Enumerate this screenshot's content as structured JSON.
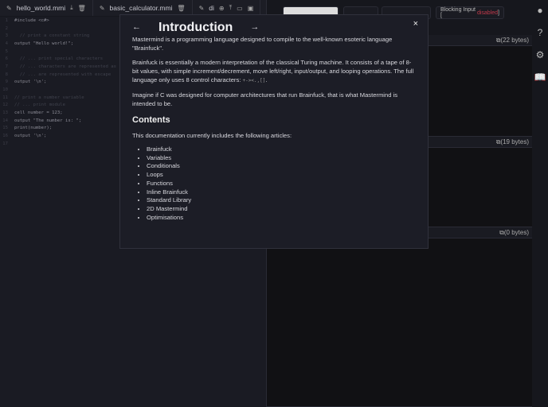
{
  "tabs": [
    {
      "label": "hello_world.mmi"
    },
    {
      "label": "basic_calculator.mmi"
    },
    {
      "label": "di"
    }
  ],
  "code": [
    {
      "n": "1",
      "t": "#include <c#>",
      "c": false
    },
    {
      "n": "2",
      "t": "",
      "c": false
    },
    {
      "n": "3",
      "t": "  // print a constant string",
      "c": true
    },
    {
      "n": "4",
      "t": "output \"Hello world!\";",
      "c": false
    },
    {
      "n": "5",
      "t": "",
      "c": false
    },
    {
      "n": "6",
      "t": "  // ... print special characters",
      "c": true
    },
    {
      "n": "7",
      "t": "  // ... characters are represented as",
      "c": true
    },
    {
      "n": "8",
      "t": "  // ... are represented with escape",
      "c": true
    },
    {
      "n": "9",
      "t": "output '\\n';",
      "c": false
    },
    {
      "n": "10",
      "t": "",
      "c": false
    },
    {
      "n": "11",
      "t": "// print a number variable",
      "c": true
    },
    {
      "n": "12",
      "t": "// ... print module",
      "c": true
    },
    {
      "n": "13",
      "t": "cell number = 123;",
      "c": false
    },
    {
      "n": "14",
      "t": "output \"The number is: \";",
      "c": false
    },
    {
      "n": "15",
      "t": "print(number);",
      "c": false
    },
    {
      "n": "16",
      "t": "output '\\n';",
      "c": false
    },
    {
      "n": "17",
      "t": "",
      "c": false
    }
  ],
  "right": {
    "blocking_label": "Blocking Input [",
    "blocking_state": "disabled",
    "blocking_end": "]",
    "out1_bytes": "(22 bytes)",
    "out2_bytes": "(19 bytes)",
    "out3_bytes": "(0 bytes)"
  },
  "modal": {
    "title": "Introduction",
    "prev": "←",
    "next": "→",
    "close": "×",
    "p1": "Mastermind is a programming language designed to compile to the well-known esoteric language \"Brainfuck\".",
    "p2": "Brainfuck is essentially a modern interpretation of the classical Turing machine. It consists of a tape of 8-bit values, with simple increment/decrement, move left/right, input/output, and looping operations. The full language only uses 8 control characters: ",
    "p2_code": "+-><.,[]",
    "p2_end": ".",
    "p3": "Imagine if C was designed for computer architectures that run Brainfuck, that is what Mastermind is intended to be.",
    "contents_title": "Contents",
    "contents_intro": "This documentation currently includes the following articles:",
    "articles": [
      "Brainfuck",
      "Variables",
      "Conditionals",
      "Loops",
      "Functions",
      "Inline Brainfuck",
      "Standard Library",
      "2D Mastermind",
      "Optimisations"
    ]
  },
  "colors": {
    "accent_disabled": "#c0394a",
    "background": "#16171d",
    "modal": "#1c1d26"
  }
}
